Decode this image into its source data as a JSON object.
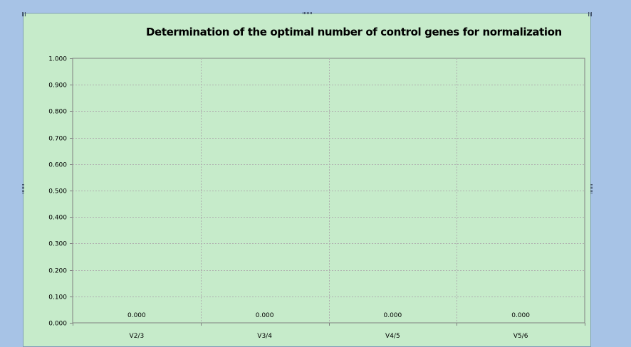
{
  "chart_data": {
    "type": "bar",
    "title": "Determination of the optimal number of control genes for normalization",
    "xlabel": "",
    "ylabel": "",
    "categories": [
      "V2/3",
      "V3/4",
      "V4/5",
      "V5/6"
    ],
    "values": [
      0,
      0,
      0,
      0
    ],
    "data_labels": [
      "0.000",
      "0.000",
      "0.000",
      "0.000"
    ],
    "ylim": [
      0,
      1
    ],
    "yticks": [
      "0.000",
      "0.100",
      "0.200",
      "0.300",
      "0.400",
      "0.500",
      "0.600",
      "0.700",
      "0.800",
      "0.900",
      "1.000"
    ],
    "grid": true,
    "legend": "none"
  },
  "colors": {
    "background": "#a7c3e6",
    "chart_area": "#c6ebca",
    "gridline": "#b0b0b0",
    "axis": "#808080"
  }
}
